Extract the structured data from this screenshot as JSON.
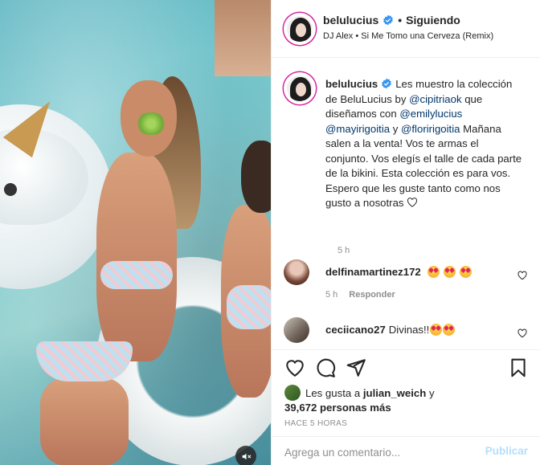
{
  "header": {
    "username": "belulucius",
    "separator": "•",
    "follow_status": "Siguiendo",
    "audio": "DJ Alex • Si Me Tomo una Cerveza (Remix)"
  },
  "caption": {
    "username": "belulucius",
    "part1": "Les muestro la colección de BeluLucius by ",
    "mention1": "@cipitriaok",
    "part2": " que diseñamos con ",
    "mention2": "@emilylucius",
    "mention3": "@mayirigoitia",
    "part3": " y ",
    "mention4": "@floririgoitia",
    "part4": " Mañana salen a la venta! Vos te armas el conjunto. Vos elegís el talle de cada parte de la bikini. Esta colección es para vos.",
    "part5": "Espero que les guste tanto como nos gusto a nosotras",
    "time": "5 h"
  },
  "comments": [
    {
      "username": "delfinamartinez172",
      "text": "",
      "time": "5 h",
      "reply": "Responder"
    },
    {
      "username": "ceciicano27",
      "text": "Divinas!!"
    }
  ],
  "likes": {
    "prefix": "Les gusta a ",
    "user": "julian_weich",
    "middle": " y",
    "count": "39,672 personas más"
  },
  "time_ago": "HACE 5 HORAS",
  "comment_box": {
    "placeholder": "Agrega un comentario...",
    "publish": "Publicar"
  },
  "icons": [
    "verified-badge-icon",
    "heart-icon",
    "comment-icon",
    "share-icon",
    "save-icon",
    "mute-icon"
  ],
  "colors": {
    "link": "#00376b",
    "muted": "#8e8e8e",
    "publish": "#b2dffc",
    "verified": "#3897f0"
  }
}
